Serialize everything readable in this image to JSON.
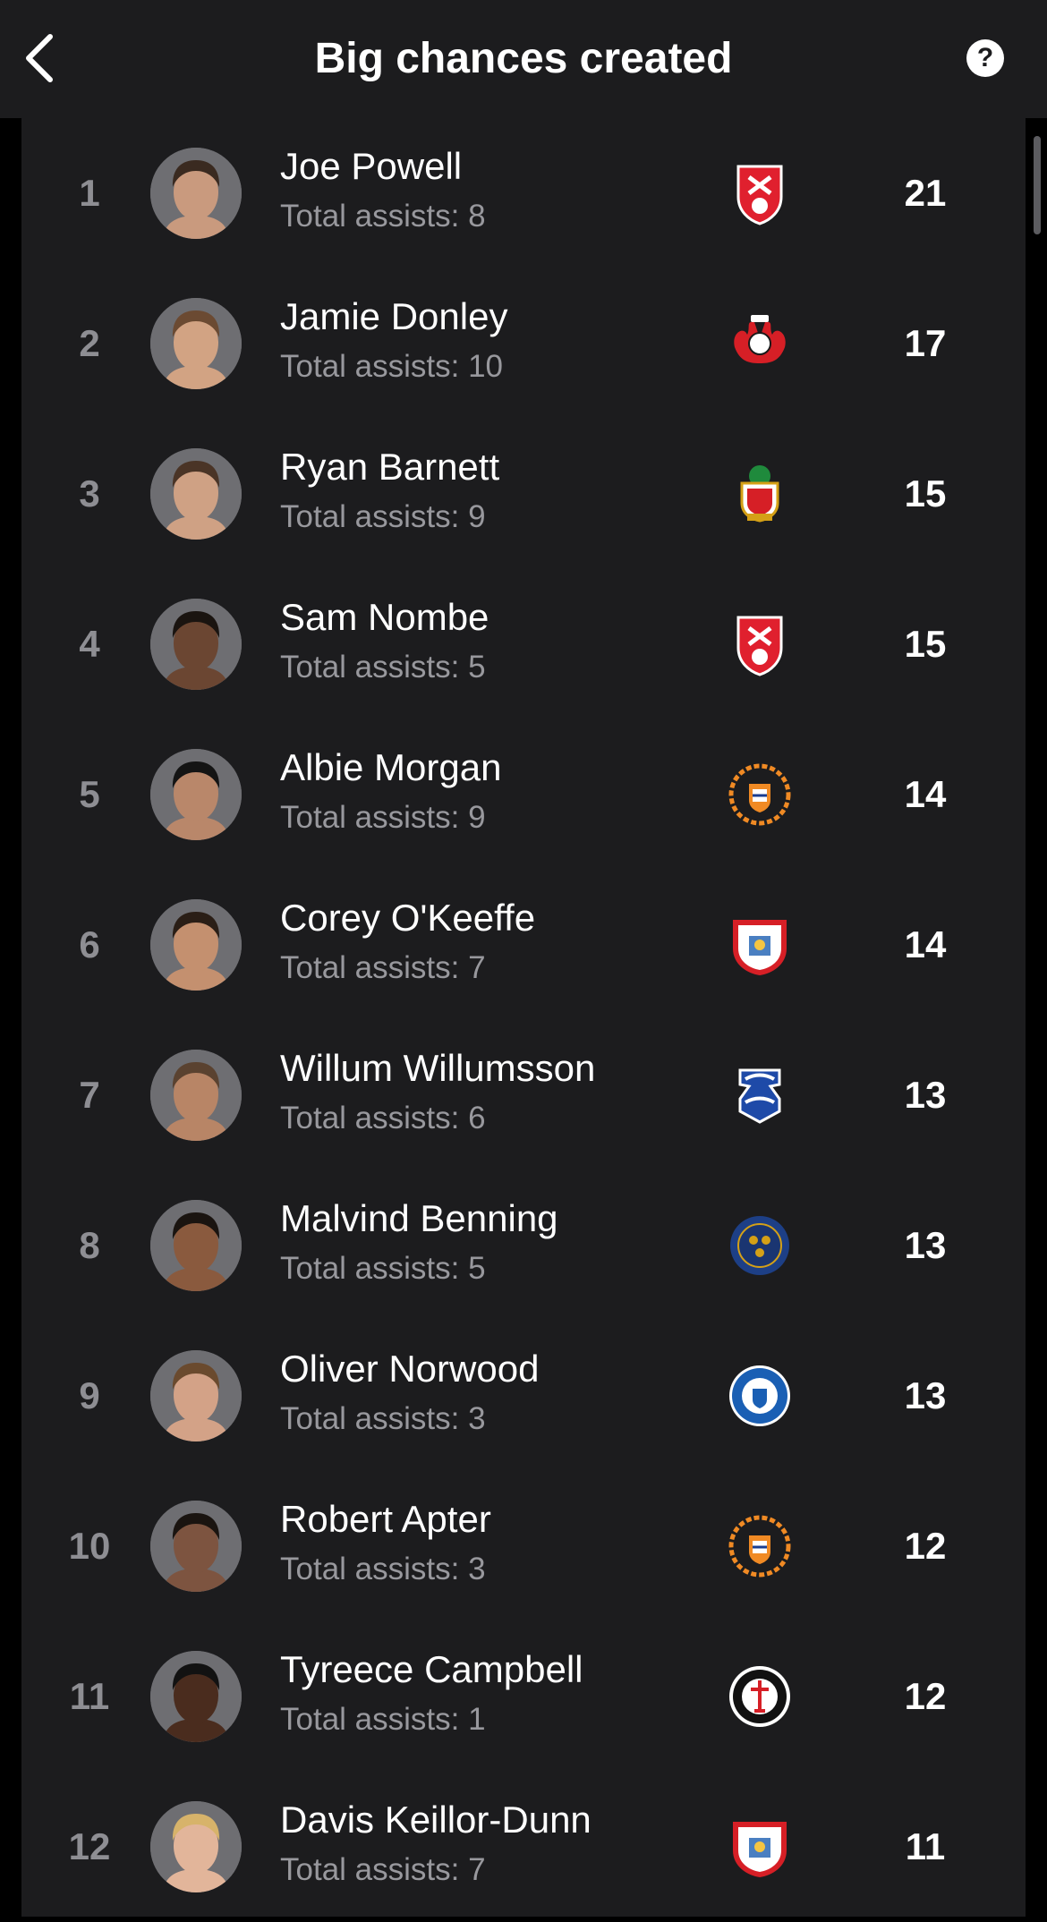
{
  "header": {
    "title": "Big chances created",
    "back_icon": "chevron-left-icon",
    "help_icon": "question-circle-icon",
    "help_glyph": "?"
  },
  "players": [
    {
      "rank": "1",
      "name": "Joe Powell",
      "sub": "Total assists: 8",
      "value": "21",
      "crest": "rotherham"
    },
    {
      "rank": "2",
      "name": "Jamie Donley",
      "sub": "Total assists: 10",
      "value": "17",
      "crest": "leyton-orient"
    },
    {
      "rank": "3",
      "name": "Ryan Barnett",
      "sub": "Total assists: 9",
      "value": "15",
      "crest": "wrexham"
    },
    {
      "rank": "4",
      "name": "Sam Nombe",
      "sub": "Total assists: 5",
      "value": "15",
      "crest": "rotherham"
    },
    {
      "rank": "5",
      "name": "Albie Morgan",
      "sub": "Total assists: 9",
      "value": "14",
      "crest": "blackpool"
    },
    {
      "rank": "6",
      "name": "Corey O'Keeffe",
      "sub": "Total assists: 7",
      "value": "14",
      "crest": "barnsley"
    },
    {
      "rank": "7",
      "name": "Willum Willumsson",
      "sub": "Total assists: 6",
      "value": "13",
      "crest": "birmingham"
    },
    {
      "rank": "8",
      "name": "Malvind Benning",
      "sub": "Total assists: 5",
      "value": "13",
      "crest": "shrewsbury"
    },
    {
      "rank": "9",
      "name": "Oliver Norwood",
      "sub": "Total assists: 3",
      "value": "13",
      "crest": "stockport"
    },
    {
      "rank": "10",
      "name": "Robert Apter",
      "sub": "Total assists: 3",
      "value": "12",
      "crest": "blackpool"
    },
    {
      "rank": "11",
      "name": "Tyreece Campbell",
      "sub": "Total assists: 1",
      "value": "12",
      "crest": "charlton"
    },
    {
      "rank": "12",
      "name": "Davis Keillor-Dunn",
      "sub": "Total assists: 7",
      "value": "11",
      "crest": "barnsley"
    }
  ],
  "skin_tones": [
    "#c99a7e",
    "#d2a383",
    "#cfa184",
    "#6b4632",
    "#b9876a",
    "#c4906f",
    "#b88566",
    "#8a5a3e",
    "#d3a287",
    "#7d5440",
    "#4a2c1e",
    "#e2b59a"
  ],
  "hair_colors": [
    "#3a2a20",
    "#6b4a32",
    "#4a3426",
    "#1a1410",
    "#141414",
    "#2a1e16",
    "#5a4230",
    "#1a1410",
    "#6a4a2e",
    "#1a1410",
    "#121212",
    "#d7b36a"
  ],
  "colors": {
    "background": "#000000",
    "panel": "#1c1c1e",
    "text_primary": "#ffffff",
    "text_secondary": "#98989d",
    "rank": "#8e8e93"
  }
}
